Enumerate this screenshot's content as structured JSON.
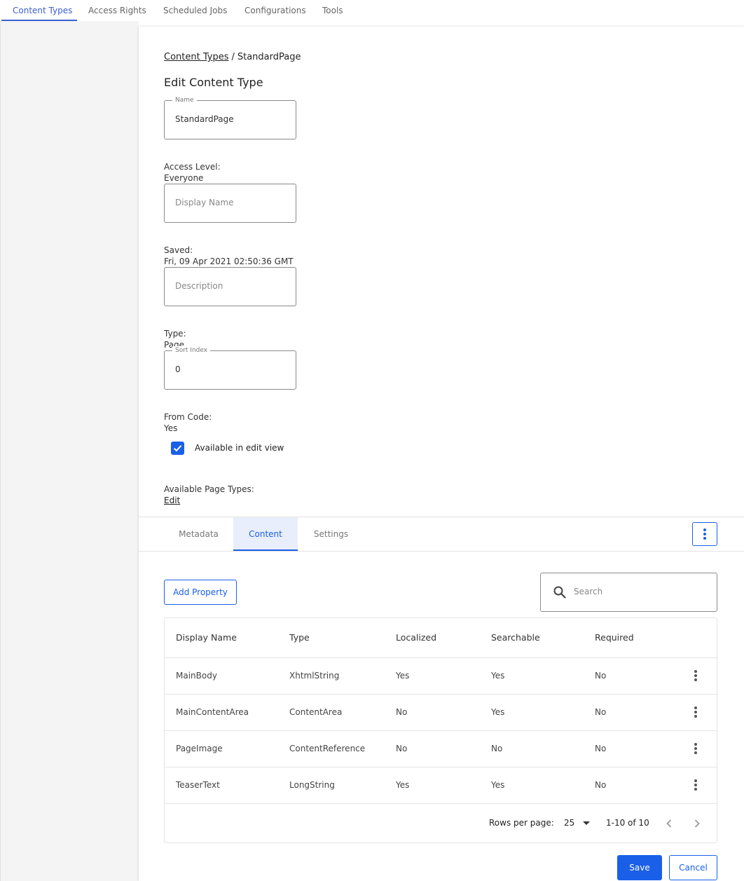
{
  "top_nav": {
    "tabs": [
      "Content Types",
      "Access Rights",
      "Scheduled Jobs",
      "Configurations",
      "Tools"
    ],
    "active_tab": "Content Types"
  },
  "breadcrumb": {
    "parent": "Content Types",
    "separator": "/",
    "current": "StandardPage"
  },
  "title": "Edit Content Type",
  "form": {
    "name": {
      "label": "Name",
      "value": "StandardPage"
    },
    "access_level": {
      "label": "Access Level:",
      "value": "Everyone"
    },
    "display_name": {
      "placeholder": "Display Name",
      "value": ""
    },
    "saved": {
      "label": "Saved:",
      "value": "Fri, 09 Apr 2021 02:50:36 GMT"
    },
    "description": {
      "placeholder": "Description",
      "value": ""
    },
    "type": {
      "label": "Type:",
      "value": "Page"
    },
    "sort_index": {
      "label": "Sort Index",
      "value": "0"
    },
    "from_code": {
      "label": "From Code:",
      "value": "Yes"
    },
    "available_in_edit_view": {
      "label": "Available in edit view",
      "checked": true
    },
    "available_page_types": {
      "label": "Available Page Types:",
      "link": "Edit"
    }
  },
  "content_tabs": {
    "tabs": [
      "Metadata",
      "Content",
      "Settings"
    ],
    "active": "Content"
  },
  "toolbar": {
    "add_property": "Add Property",
    "search_placeholder": "Search"
  },
  "table": {
    "columns": [
      "Display Name",
      "Type",
      "Localized",
      "Searchable",
      "Required"
    ],
    "rows": [
      [
        "MainBody",
        "XhtmlString",
        "Yes",
        "Yes",
        "No"
      ],
      [
        "MainContentArea",
        "ContentArea",
        "No",
        "Yes",
        "No"
      ],
      [
        "PageImage",
        "ContentReference",
        "No",
        "No",
        "No"
      ],
      [
        "TeaserText",
        "LongString",
        "Yes",
        "Yes",
        "No"
      ]
    ]
  },
  "pagination": {
    "rows_per_page_label": "Rows per page:",
    "rows_per_page": "25",
    "range": "1-10 of 10"
  },
  "actions": {
    "save": "Save",
    "cancel": "Cancel"
  },
  "colors": {
    "accent": "#1a5fe8",
    "nav_active": "#3a5fd1",
    "rail": "#f4f4f4",
    "tab_active_bg": "#e8eefb"
  }
}
